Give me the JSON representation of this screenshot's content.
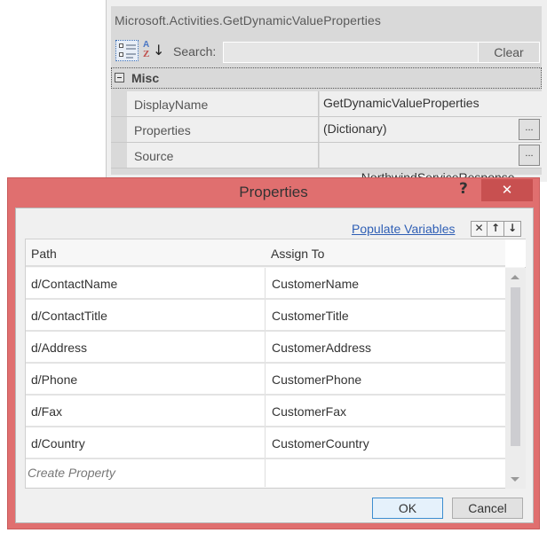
{
  "property_grid": {
    "type_name": "Microsoft.Activities.GetDynamicValueProperties",
    "toolbar": {
      "categorized_icon": "categorized-view-icon",
      "alphabetical_icon": "sort-az-icon",
      "search_label": "Search:",
      "search_value": "",
      "clear_label": "Clear"
    },
    "category": {
      "name": "Misc",
      "expand_icon": "collapse-minus-icon"
    },
    "rows": [
      {
        "name": "DisplayName",
        "value": "GetDynamicValueProperties",
        "has_ellipsis": false
      },
      {
        "name": "Properties",
        "value": "(Dictionary)",
        "has_ellipsis": true,
        "ellipsis_label": "..."
      },
      {
        "name": "Source",
        "value": " NorthwindServiceResponse",
        "has_ellipsis": true,
        "ellipsis_label": "..."
      }
    ]
  },
  "dialog": {
    "title": "Properties",
    "help_label": "?",
    "close_label": "✕",
    "accent_color": "#e06f6f",
    "populate_link": "Populate Variables",
    "tool_buttons": [
      {
        "name": "delete",
        "icon": "delete-x-icon",
        "glyph": "✕"
      },
      {
        "name": "move-up",
        "icon": "arrow-up-icon",
        "glyph": "↑"
      },
      {
        "name": "move-down",
        "icon": "arrow-down-icon",
        "glyph": "↓"
      }
    ],
    "grid": {
      "columns": [
        "Path",
        "Assign To"
      ],
      "rows": [
        {
          "path": "d/ContactName",
          "assign_to": "CustomerName"
        },
        {
          "path": "d/ContactTitle",
          "assign_to": "CustomerTitle"
        },
        {
          "path": "d/Address",
          "assign_to": "CustomerAddress"
        },
        {
          "path": "d/Phone",
          "assign_to": "CustomerPhone"
        },
        {
          "path": "d/Fax",
          "assign_to": "CustomerFax"
        },
        {
          "path": "d/Country",
          "assign_to": "CustomerCountry"
        }
      ],
      "new_row_placeholder": "Create Property"
    },
    "ok_label": "OK",
    "cancel_label": "Cancel"
  }
}
